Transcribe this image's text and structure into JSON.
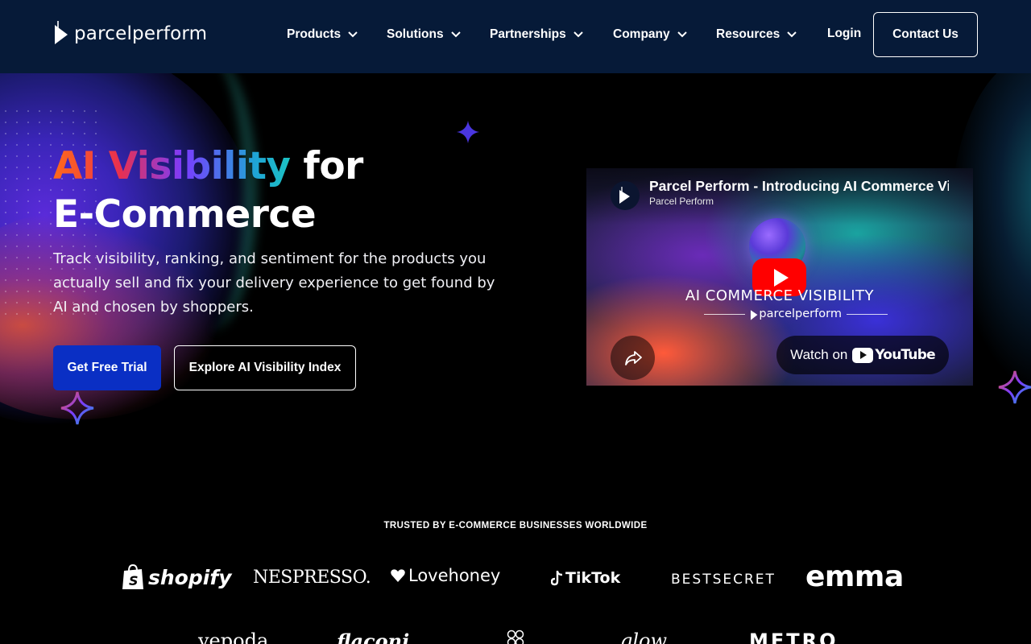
{
  "nav": {
    "logo_text": "parcelperform",
    "menu": [
      {
        "label": "Products"
      },
      {
        "label": "Solutions"
      },
      {
        "label": "Partnerships"
      },
      {
        "label": "Company"
      },
      {
        "label": "Resources"
      }
    ],
    "login": "Login",
    "contact": "Contact Us"
  },
  "hero": {
    "title_gradient": "AI Visibility",
    "title_rest_line1": " for",
    "title_line2": "E-Commerce",
    "subtext": "Track visibility, ranking, and sentiment for the products you actually sell and fix your delivery experience to get found by AI and chosen by shoppers.",
    "cta_primary": "Get Free Trial",
    "cta_secondary": "Explore AI Visibility Index"
  },
  "video": {
    "title": "Parcel Perform - Introducing AI Commerce Vi",
    "channel": "Parcel Perform",
    "heading": "AI COMMERCE VISIBILITY",
    "brand": "parcelperform",
    "watch_on": "Watch on",
    "youtube": "YouTube"
  },
  "trusted": {
    "heading": "TRUSTED BY E-COMMERCE BUSINESSES WORLDWIDE",
    "row1": [
      "shopify",
      "NESPRESSO.",
      "Lovehoney",
      "TikTok",
      "BESTSECRET",
      "emma"
    ],
    "row2": [
      "yepoda",
      "flaconi",
      "glow",
      "METRO"
    ]
  },
  "colors": {
    "nav_bg": "#061a38",
    "primary_button": "#0a2fc4",
    "youtube_red": "#ff0000"
  }
}
